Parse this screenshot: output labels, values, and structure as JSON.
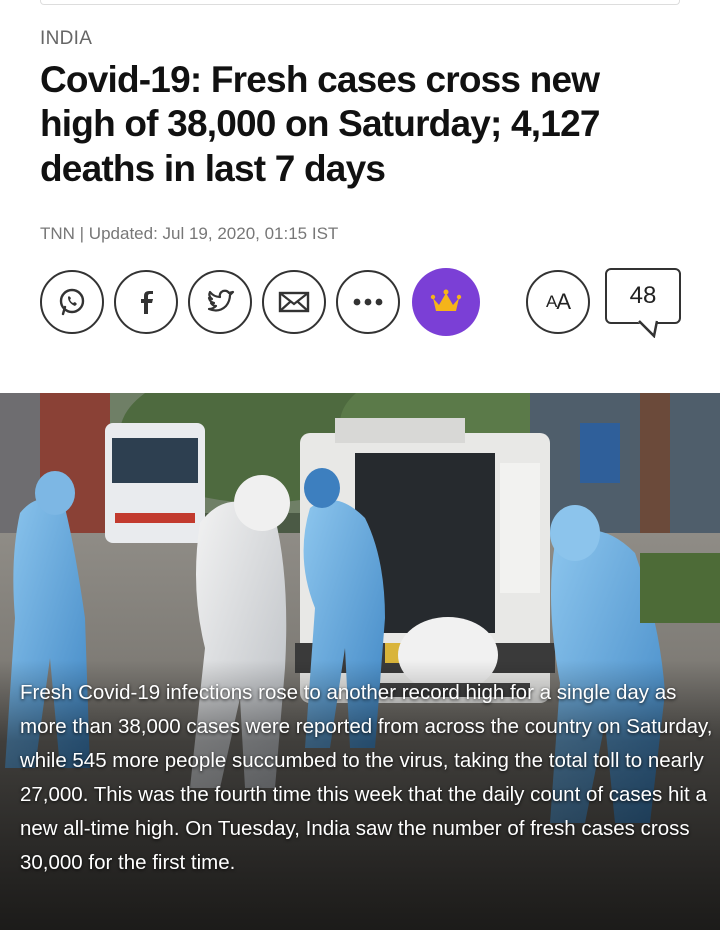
{
  "article": {
    "section": "INDIA",
    "headline": "Covid-19: Fresh cases cross new high of 38,000 on Saturday; 4,127 deaths in last 7 days",
    "byline": "TNN | Updated: Jul 19, 2020, 01:15 IST"
  },
  "share_bar": {
    "icons": [
      "whatsapp-icon",
      "facebook-icon",
      "twitter-icon",
      "mail-icon",
      "more-icon",
      "crown-icon"
    ],
    "font_size_label_big": "A",
    "font_size_label_small": "A",
    "comment_count": "48",
    "crown_color": "#7b3fd6"
  },
  "photo": {
    "caption": "Fresh Covid-19 infections rose to another record high for a single day as more than 38,000 cases were reported from across the country on Saturday, while 545 more people succumbed to the virus, taking the total toll to nearly 27,000. This was the fourth time this week that the daily count of cases hit a new all-time high. On Tuesday, India saw the number of fresh cases cross 30,000 for the first time."
  }
}
